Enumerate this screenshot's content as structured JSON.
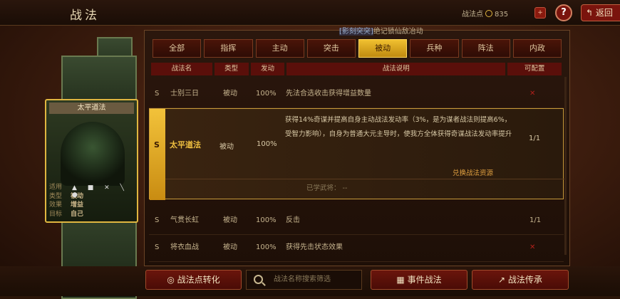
{
  "header": {
    "title": "战法",
    "currency_label": "战法点",
    "currency_value": "835",
    "back_label": "返回"
  },
  "banner": {
    "highlight": "[影刻突突]",
    "text": "绝记锁仙敌冶动"
  },
  "tabs": [
    "全部",
    "指挥",
    "主动",
    "突击",
    "被动",
    "兵种",
    "阵法",
    "内政"
  ],
  "active_tab_index": 4,
  "table_headers": [
    "战法名",
    "类型",
    "发动",
    "战法说明",
    "可配置"
  ],
  "rows": [
    {
      "level": "S",
      "name": "士别三日",
      "type": "被动",
      "rate": "100%",
      "desc": "先法合选收击获得增益数量",
      "count": "",
      "red": true
    },
    {
      "level": "S",
      "name": "气贯长虹",
      "type": "被动",
      "rate": "100%",
      "desc": "反击",
      "count": "1/1",
      "red": false
    },
    {
      "level": "S",
      "name": "将衣血战",
      "type": "被动",
      "rate": "100%",
      "desc": "获得先击状态效果",
      "count": "",
      "red": true
    }
  ],
  "selected_row": {
    "level": "S",
    "name": "太平道法",
    "type": "被动",
    "rate": "100%",
    "desc": "获得14%奇谋并提高自身主动战法发动率（3%，是为谋者战法则提高6%，受智力影响），自身为普通大元主导时，使我方全体获得奇谋战法发动率提升",
    "count": "1/1",
    "link": "兑换战法资源",
    "learned_label": "已学武将：",
    "learned_value": "--"
  },
  "card": {
    "name": "太平道法",
    "info": [
      {
        "k": "适用",
        "v": ""
      },
      {
        "k": "类型",
        "v": "被动"
      },
      {
        "k": "效果",
        "v": "增益"
      },
      {
        "k": "目标",
        "v": "自己"
      }
    ],
    "icons": "▲ ■ ✕ ╲ ●"
  },
  "bottom": {
    "convert_label": "战法点转化",
    "search_placeholder": "战法名称搜索筛选",
    "conditions_label": "事件战法",
    "inherit_label": "战法传承"
  },
  "colors": {
    "accent_gold": "#f0c030",
    "tab_red": "#4a1408",
    "header_red": "#5a0f0a"
  }
}
